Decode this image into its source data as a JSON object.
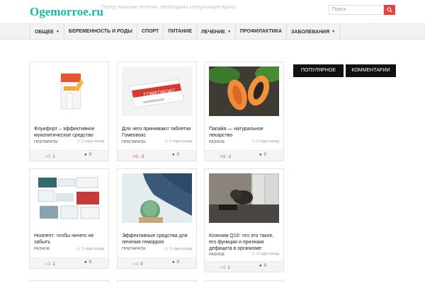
{
  "header": {
    "logo": "Ogemorroe.ru",
    "tagline": "Перед началом лечения, необходима консультация врача.",
    "search_placeholder": "Поиск"
  },
  "nav": {
    "items": [
      {
        "label": "ОБЩЕЕ",
        "dropdown": true
      },
      {
        "label": "БЕРЕМЕННОСТЬ И РОДЫ",
        "dropdown": false
      },
      {
        "label": "СПОРТ",
        "dropdown": false
      },
      {
        "label": "ПИТАНИЕ",
        "dropdown": false
      },
      {
        "label": "ЛЕЧЕНИЕ",
        "dropdown": true
      },
      {
        "label": "ПРОФИЛАКТИКА",
        "dropdown": false
      },
      {
        "label": "ЗАБОЛЕВАНИЯ",
        "dropdown": true
      }
    ]
  },
  "sidebar": {
    "tabs": [
      "ПОПУЛЯРНОЕ",
      "КОММЕНТАРИИ"
    ]
  },
  "posts": [
    {
      "title": "Флуифорт – эффективное муколитическое средство",
      "category": "ПРЕПАРАТЫ",
      "time": "2 года назад",
      "votes": "1",
      "vote_type": "up",
      "comments": "0",
      "image": "fluifort-box"
    },
    {
      "title": "Для чего принимают таблетки Гомеовокс",
      "category": "ПРЕПАРАТЫ",
      "time": "2 года назад",
      "votes": "-2",
      "vote_type": "down",
      "comments": "0",
      "image": "gomeovoks-box"
    },
    {
      "title": "Папайя — натуральное лекарство",
      "category": "РАЗНОЕ",
      "time": "3 года назад",
      "votes": "-1",
      "vote_type": "down",
      "comments": "0",
      "image": "papaya"
    },
    {
      "title": "Ноопепт: чтобы ничего не забыть",
      "category": "РАЗНОЕ",
      "time": "3 года назад",
      "votes": "1",
      "vote_type": "up",
      "comments": "0",
      "image": "noopept-boxes"
    },
    {
      "title": "Эффективные средства для лечения геморроя",
      "category": "ПРЕПАРАТЫ",
      "time": "3 года назад",
      "votes": "0",
      "vote_type": "up",
      "comments": "0",
      "image": "cactus"
    },
    {
      "title": "Коэнзим Q10: что это такое, его функции и признаки дефицита в организме",
      "category": "РАЗНОЕ",
      "time": "3 года назад",
      "votes": "1",
      "vote_type": "up",
      "comments": "0",
      "image": "tired-person"
    }
  ],
  "colors": {
    "logo": "#1bb8a8",
    "search_button": "#e8413b",
    "upvote": "#49a942",
    "downvote": "#d9363e",
    "tab_bg": "#111111"
  }
}
